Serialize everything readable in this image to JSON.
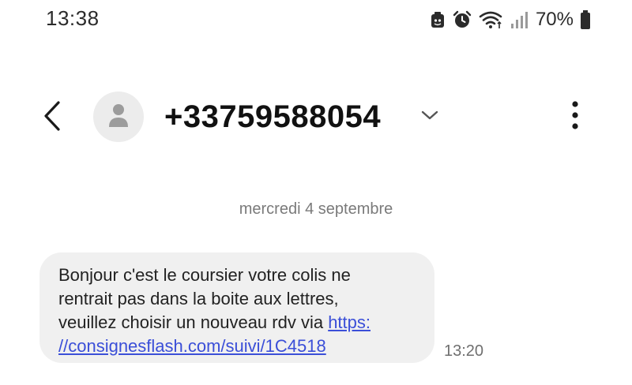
{
  "status_bar": {
    "time": "13:38",
    "icons": [
      "android-icon",
      "alarm-icon",
      "wifi-icon",
      "signal-icon",
      "battery-icon"
    ],
    "battery_percent": "70%"
  },
  "header": {
    "back_icon": "chevron-left-icon",
    "avatar_icon": "person-icon",
    "contact": "+33759588054",
    "expand_icon": "chevron-down-icon",
    "more_icon": "more-vertical-icon"
  },
  "conversation": {
    "date_separator": "mercredi 4 septembre",
    "messages": [
      {
        "lines": [
          "Bonjour c'est le coursier votre colis ne",
          "rentrait pas dans la boite aux lettres,",
          "veuillez choisir un nouveau rdv via "
        ],
        "link_part1": "https:",
        "link_part2": "//consignesflash.com/suivi/1C4518",
        "time": "13:20"
      }
    ]
  },
  "colors": {
    "background": "#ffffff",
    "bubble": "#f0f0f0",
    "link": "#3b4fd8",
    "secondary_text": "#7a7a7a"
  }
}
